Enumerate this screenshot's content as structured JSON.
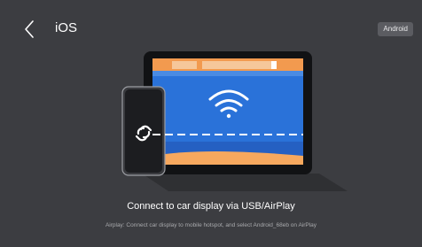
{
  "header": {
    "title": "iOS",
    "android_button_label": "Android"
  },
  "main": {
    "headline": "Connect to car display via USB/AirPlay",
    "subtext": "Airplay: Connect car display to mobile hotspot, and select Android_68eb on AirPlay"
  },
  "colors": {
    "background": "#3c3d41",
    "car_screen_blue": "#1f6fd6",
    "car_bar_orange": "#f29a4f",
    "car_bar_light": "#f6c79a",
    "accent_white": "#ffffff"
  },
  "icons": {
    "back": "chevron-left-icon",
    "wifi": "wifi-icon",
    "link": "link-icon"
  }
}
